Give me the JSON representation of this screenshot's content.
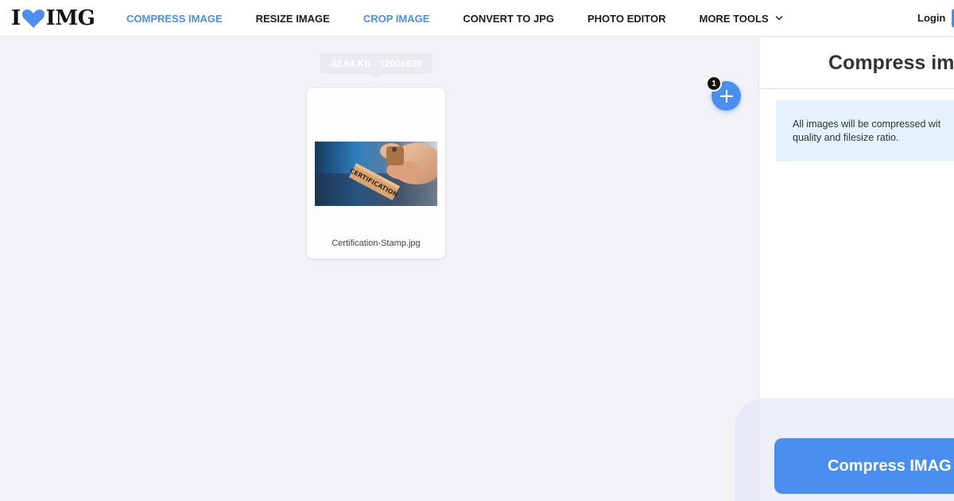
{
  "header": {
    "logo_left": "I",
    "logo_right": "IMG",
    "nav": [
      {
        "label": "COMPRESS IMAGE",
        "active": true
      },
      {
        "label": "RESIZE IMAGE",
        "active": false
      },
      {
        "label": "CROP IMAGE",
        "active": true
      },
      {
        "label": "CONVERT TO JPG",
        "active": false
      },
      {
        "label": "PHOTO EDITOR",
        "active": false
      },
      {
        "label": "MORE TOOLS",
        "active": false
      }
    ],
    "login_label": "Login"
  },
  "workspace": {
    "tooltip": "42.64 KB - 1200x630",
    "file": {
      "name": "Certification-Stamp.jpg",
      "thumb_text": "CERTIFICATION"
    },
    "add_badge": "1"
  },
  "sidebar": {
    "title": "Compress ima",
    "info_line1": "All images will be compressed wit",
    "info_line2": "quality and filesize ratio.",
    "compress_button": "Compress IMAG"
  },
  "colors": {
    "accent": "#4a8ff0",
    "info_bg": "#e3f2fd",
    "workspace_bg": "#f3f3f7"
  }
}
